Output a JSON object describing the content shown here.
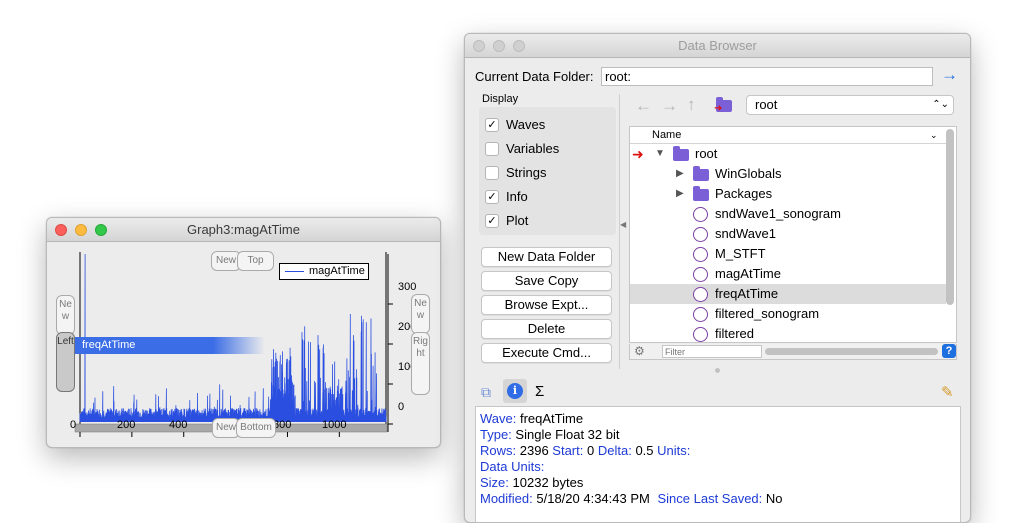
{
  "graph": {
    "title": "Graph3:magAtTime",
    "buttons": {
      "new_top": "New",
      "top": "Top",
      "new_bottom": "New",
      "bottom": "Bottom",
      "new_left": "New",
      "left": "Left",
      "new_right": "New",
      "right": "Right"
    },
    "legend": "magAtTime",
    "drag_label": "freqAtTime",
    "x_ticks": [
      "0",
      "200",
      "400",
      "600",
      "800",
      "1000"
    ],
    "y_ticks": [
      "300",
      "200",
      "100",
      "0"
    ],
    "colors": {
      "trace": "#2a4fe0"
    }
  },
  "browser": {
    "title": "Data Browser",
    "current_folder_label": "Current Data Folder:",
    "current_folder_value": "root:",
    "display_label": "Display",
    "checks": [
      {
        "label": "Waves",
        "checked": true
      },
      {
        "label": "Variables",
        "checked": false
      },
      {
        "label": "Strings",
        "checked": false
      },
      {
        "label": "Info",
        "checked": true
      },
      {
        "label": "Plot",
        "checked": true
      }
    ],
    "check_mark": "✓",
    "buttons": [
      "New Data Folder",
      "Save Copy",
      "Browse Expt...",
      "Delete",
      "Execute Cmd..."
    ],
    "folder_select": "root",
    "column_header": "Name",
    "tree": [
      {
        "label": "root",
        "kind": "folder",
        "indent": 0,
        "open": true,
        "current": true
      },
      {
        "label": "WinGlobals",
        "kind": "folder",
        "indent": 1,
        "open": false
      },
      {
        "label": "Packages",
        "kind": "folder",
        "indent": 1,
        "open": false
      },
      {
        "label": "sndWave1_sonogram",
        "kind": "wave",
        "indent": 1
      },
      {
        "label": "sndWave1",
        "kind": "wave",
        "indent": 1
      },
      {
        "label": "M_STFT",
        "kind": "wave",
        "indent": 1
      },
      {
        "label": "magAtTime",
        "kind": "wave",
        "indent": 1
      },
      {
        "label": "freqAtTime",
        "kind": "wave",
        "indent": 1,
        "selected": true
      },
      {
        "label": "filtered_sonogram",
        "kind": "wave",
        "indent": 1
      },
      {
        "label": "filtered",
        "kind": "wave",
        "indent": 1
      }
    ],
    "filter_placeholder": "Filter",
    "tab_sigma": "Σ",
    "info": {
      "wave_k": "Wave:",
      "wave_v": "freqAtTime",
      "type_k": "Type:",
      "type_v": "Single Float 32 bit",
      "rows_k": "Rows:",
      "rows_v": "2396",
      "start_k": "Start:",
      "start_v": "0",
      "delta_k": "Delta:",
      "delta_v": "0.5",
      "units_k": "Units:",
      "dataunits_k": "Data Units:",
      "size_k": "Size:",
      "size_v": "10232 bytes",
      "modified_k": "Modified:",
      "modified_v": "5/18/20 4:34:43 PM",
      "since_k": "Since Last Saved:",
      "since_v": "No"
    }
  }
}
